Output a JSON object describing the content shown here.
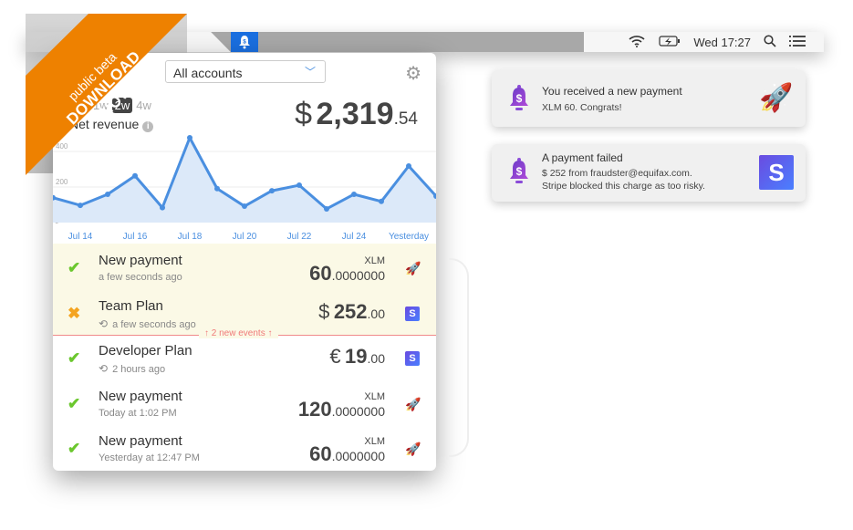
{
  "menubar": {
    "clock": "Wed 17:27",
    "icons": [
      "wifi-icon",
      "battery-charging-icon",
      "search-icon",
      "list-icon"
    ],
    "app_icon": "bell-dollar-icon",
    "accent": "#1a6fe0"
  },
  "ribbon": {
    "line1": "public beta",
    "line2": "DOWNLOAD NOW",
    "color": "#ee8100"
  },
  "panel": {
    "account_select": "All accounts",
    "periods": [
      "1w",
      "2w",
      "4w"
    ],
    "active_period": "2w",
    "metric_label": "Net revenue",
    "total": {
      "currency": "$",
      "integer": "2,319",
      "decimal": ".54"
    },
    "new_events_label": "2 new events",
    "events": [
      {
        "status": "success",
        "title": "New payment",
        "subtitle": "a few seconds ago",
        "recurring": false,
        "unit": "XLM",
        "currency": "",
        "integer": "60",
        "decimal": ".0000000",
        "source": "stellar-rocket-icon",
        "new": true
      },
      {
        "status": "failed",
        "title": "Team Plan",
        "subtitle": "a few seconds ago",
        "recurring": true,
        "unit": "",
        "currency": "$",
        "integer": "252",
        "decimal": ".00",
        "source": "stripe-icon",
        "new": true
      },
      {
        "status": "success",
        "title": "Developer Plan",
        "subtitle": "2 hours ago",
        "recurring": true,
        "unit": "",
        "currency": "€",
        "integer": "19",
        "decimal": ".00",
        "source": "stripe-icon",
        "new": false
      },
      {
        "status": "success",
        "title": "New payment",
        "subtitle": "Today at 1:02 PM",
        "recurring": false,
        "unit": "XLM",
        "currency": "",
        "integer": "120",
        "decimal": ".0000000",
        "source": "stellar-rocket-icon",
        "new": false
      },
      {
        "status": "success",
        "title": "New payment",
        "subtitle": "Yesterday at 12:47 PM",
        "recurring": false,
        "unit": "XLM",
        "currency": "",
        "integer": "60",
        "decimal": ".0000000",
        "source": "stellar-rocket-icon",
        "new": false
      }
    ]
  },
  "chart_data": {
    "type": "area",
    "x": [
      "Jul 13",
      "Jul 14",
      "Jul 15",
      "Jul 16",
      "Jul 17",
      "Jul 18",
      "Jul 19",
      "Jul 20",
      "Jul 21",
      "Jul 22",
      "Jul 23",
      "Jul 24",
      "Jul 25",
      "Yesterday",
      "Today"
    ],
    "values": [
      140,
      97,
      159,
      263,
      84,
      477,
      191,
      92,
      179,
      210,
      77,
      159,
      119,
      318,
      149
    ],
    "x_tick_labels": [
      "Jul 14",
      "Jul 16",
      "Jul 18",
      "Jul 20",
      "Jul 22",
      "Jul 24",
      "Yesterday"
    ],
    "y_ticks": [
      0,
      200,
      400
    ],
    "ylim": [
      0,
      450
    ],
    "grid": true,
    "line_color": "#4a8fe0",
    "fill_color": "#dce9f9"
  },
  "notifications": [
    {
      "title": "You received a new payment",
      "body": [
        "XLM 60. Congrats!"
      ],
      "image": "stellar-rocket-icon"
    },
    {
      "title": "A payment failed",
      "body": [
        "$ 252 from fraudster@equifax.com.",
        "Stripe blocked this charge as too risky."
      ],
      "image": "stripe-icon"
    }
  ]
}
